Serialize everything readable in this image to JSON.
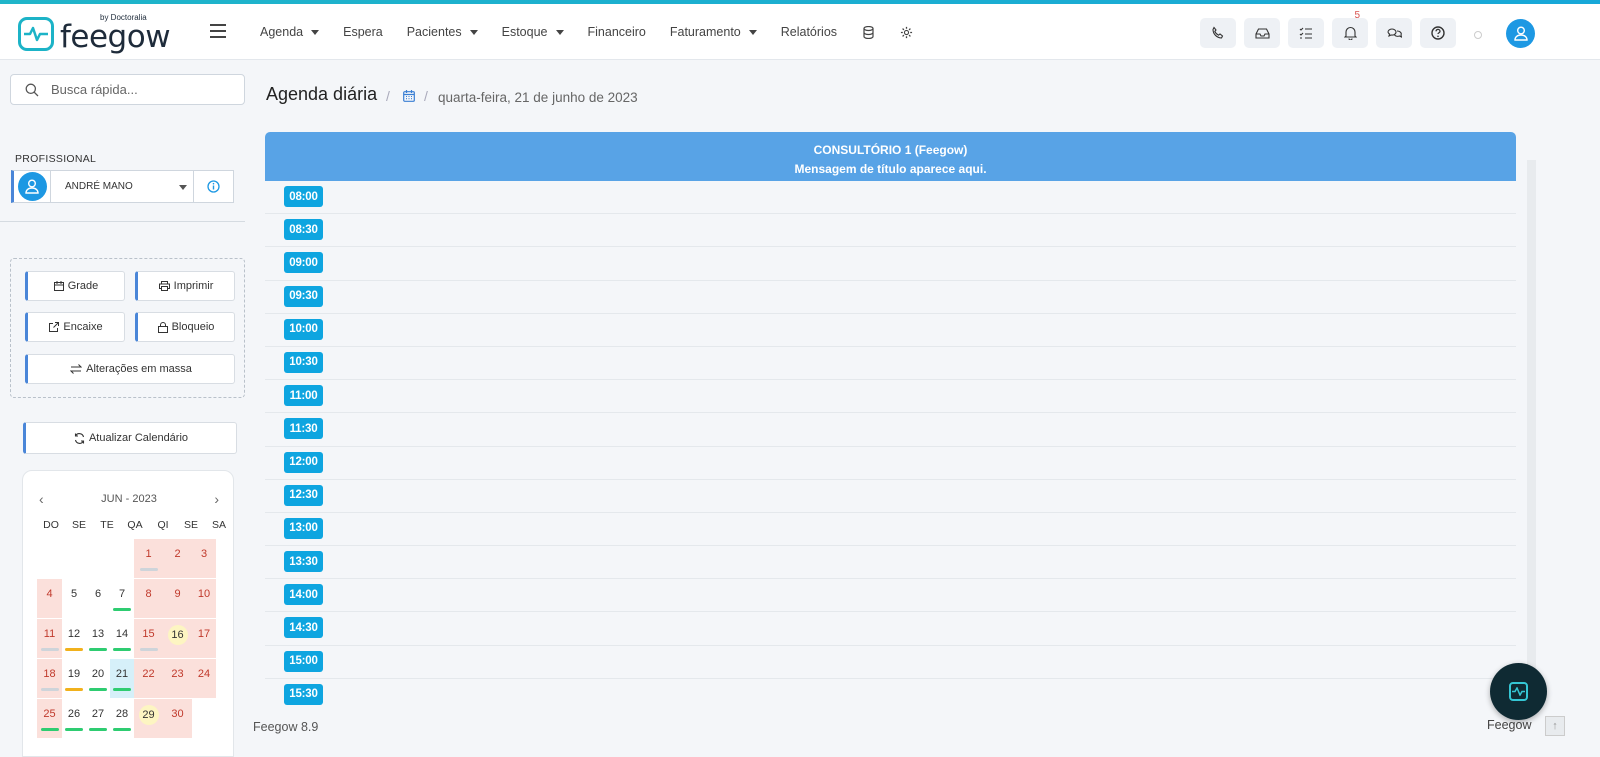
{
  "header": {
    "logo_text": "feegow",
    "logo_sub": "by Doctoralia",
    "nav": [
      {
        "label": "Agenda",
        "dropdown": true
      },
      {
        "label": "Espera",
        "dropdown": false
      },
      {
        "label": "Pacientes",
        "dropdown": true
      },
      {
        "label": "Estoque",
        "dropdown": true
      },
      {
        "label": "Financeiro",
        "dropdown": false
      },
      {
        "label": "Faturamento",
        "dropdown": true
      },
      {
        "label": "Relatórios",
        "dropdown": false
      }
    ],
    "icons": [
      "phone-icon",
      "inbox-icon",
      "tasks-icon",
      "bell-icon",
      "chat-icon",
      "help-icon"
    ],
    "notification_count": "5"
  },
  "sidebar": {
    "search_placeholder": "Busca rápida...",
    "professional_label": "PROFISSIONAL",
    "professional_name": "ANDRÉ MANO",
    "actions": {
      "grade": "Grade",
      "imprimir": "Imprimir",
      "encaixe": "Encaixe",
      "bloqueio": "Bloqueio",
      "alteracoes": "Alterações em massa"
    },
    "refresh_label": "Atualizar Calendário",
    "calendar": {
      "month_label": "JUN - 2023",
      "weekdays": [
        "DO",
        "SE",
        "TE",
        "QA",
        "QI",
        "SE",
        "SA"
      ]
    }
  },
  "main": {
    "title": "Agenda diária",
    "date": "quarta-feira, 21 de junho de 2023",
    "room_title": "CONSULTÓRIO 1 (Feegow)",
    "room_message": "Mensagem de título aparece aqui.",
    "slots": [
      "08:00",
      "08:30",
      "09:00",
      "09:30",
      "10:00",
      "10:30",
      "11:00",
      "11:30",
      "12:00",
      "12:30",
      "13:00",
      "13:30",
      "14:00",
      "14:30",
      "15:00",
      "15:30"
    ]
  },
  "footer": {
    "version": "Feegow 8.9",
    "brand": "Feegow"
  },
  "colors": {
    "accent": "#1cb3c7",
    "primary": "#1d98e3",
    "room_header": "#58a3e6",
    "slot_badge": "#0ea5e0"
  }
}
